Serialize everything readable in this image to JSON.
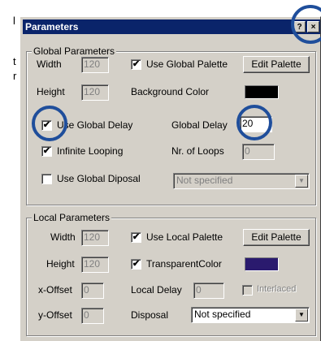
{
  "background_text": [
    "l",
    "t",
    "r"
  ],
  "dialog": {
    "title": "Parameters",
    "help_button": "?",
    "close_button": "×"
  },
  "global": {
    "legend": "Global Parameters",
    "width_label": "Width",
    "width_value": "120",
    "height_label": "Height",
    "height_value": "120",
    "use_global_palette": {
      "label": "Use Global Palette",
      "checked": true
    },
    "edit_palette_button": "Edit Palette",
    "background_color_label": "Background Color",
    "background_color": "#000000",
    "use_global_delay": {
      "label": "Use Global Delay",
      "checked": true
    },
    "global_delay_label": "Global Delay",
    "global_delay_value": "20",
    "infinite_looping": {
      "label": "Infinite Looping",
      "checked": true
    },
    "nr_of_loops_label": "Nr. of Loops",
    "nr_of_loops_value": "0",
    "use_global_disposal": {
      "label": "Use Global Diposal",
      "checked": false
    },
    "disposal_select": "Not specified"
  },
  "local": {
    "legend": "Local Parameters",
    "width_label": "Width",
    "width_value": "120",
    "height_label": "Height",
    "height_value": "120",
    "use_local_palette": {
      "label": "Use Local Palette",
      "checked": true
    },
    "edit_palette_button": "Edit Palette",
    "transparent_color": {
      "label": "TransparentColor",
      "checked": true
    },
    "transparent_color_swatch": "#2a1a6e",
    "x_offset_label": "x-Offset",
    "x_offset_value": "0",
    "local_delay_label": "Local Delay",
    "local_delay_value": "0",
    "interlaced": {
      "label": "Interlaced",
      "checked": false
    },
    "y_offset_label": "y-Offset",
    "y_offset_value": "0",
    "disposal_label": "Disposal",
    "disposal_select": "Not specified"
  },
  "colors": {
    "highlight_ring": "#1f4e9b",
    "titlebar": "#0a246a",
    "dialog_face": "#d4d0c8"
  }
}
